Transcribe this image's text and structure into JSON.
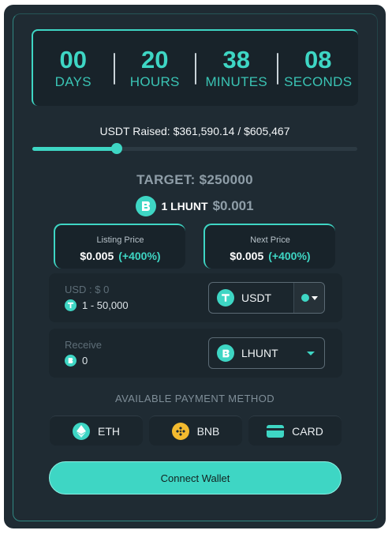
{
  "countdown": {
    "days": {
      "value": "00",
      "label": "DAYS"
    },
    "hours": {
      "value": "20",
      "label": "HOURS"
    },
    "minutes": {
      "value": "38",
      "label": "MINUTES"
    },
    "seconds": {
      "value": "08",
      "label": "SECONDS"
    }
  },
  "raised": {
    "text": "USDT Raised: $361,590.14 / $605,467",
    "progress_fraction": 0.26
  },
  "target": "TARGET: $250000",
  "token": {
    "amount": "1 LHUNT",
    "price": "$0.001"
  },
  "listing": {
    "label": "Listing Price",
    "value": "$0.005",
    "change": "(+400%)"
  },
  "next": {
    "label": "Next Price",
    "value": "$0.005",
    "change": "(+400%)"
  },
  "pay": {
    "label": "USD : $ 0",
    "range": "1 - 50,000",
    "currency": "USDT"
  },
  "receive": {
    "label": "Receive",
    "amount": "0",
    "currency": "LHUNT"
  },
  "payment_methods": {
    "title": "AVAILABLE PAYMENT METHOD",
    "eth": "ETH",
    "bnb": "BNB",
    "card": "CARD"
  },
  "connect_label": "Connect Wallet",
  "colors": {
    "accent": "#3ed6c4",
    "panel": "#1f2b33",
    "bnb": "#f3ba2f"
  }
}
